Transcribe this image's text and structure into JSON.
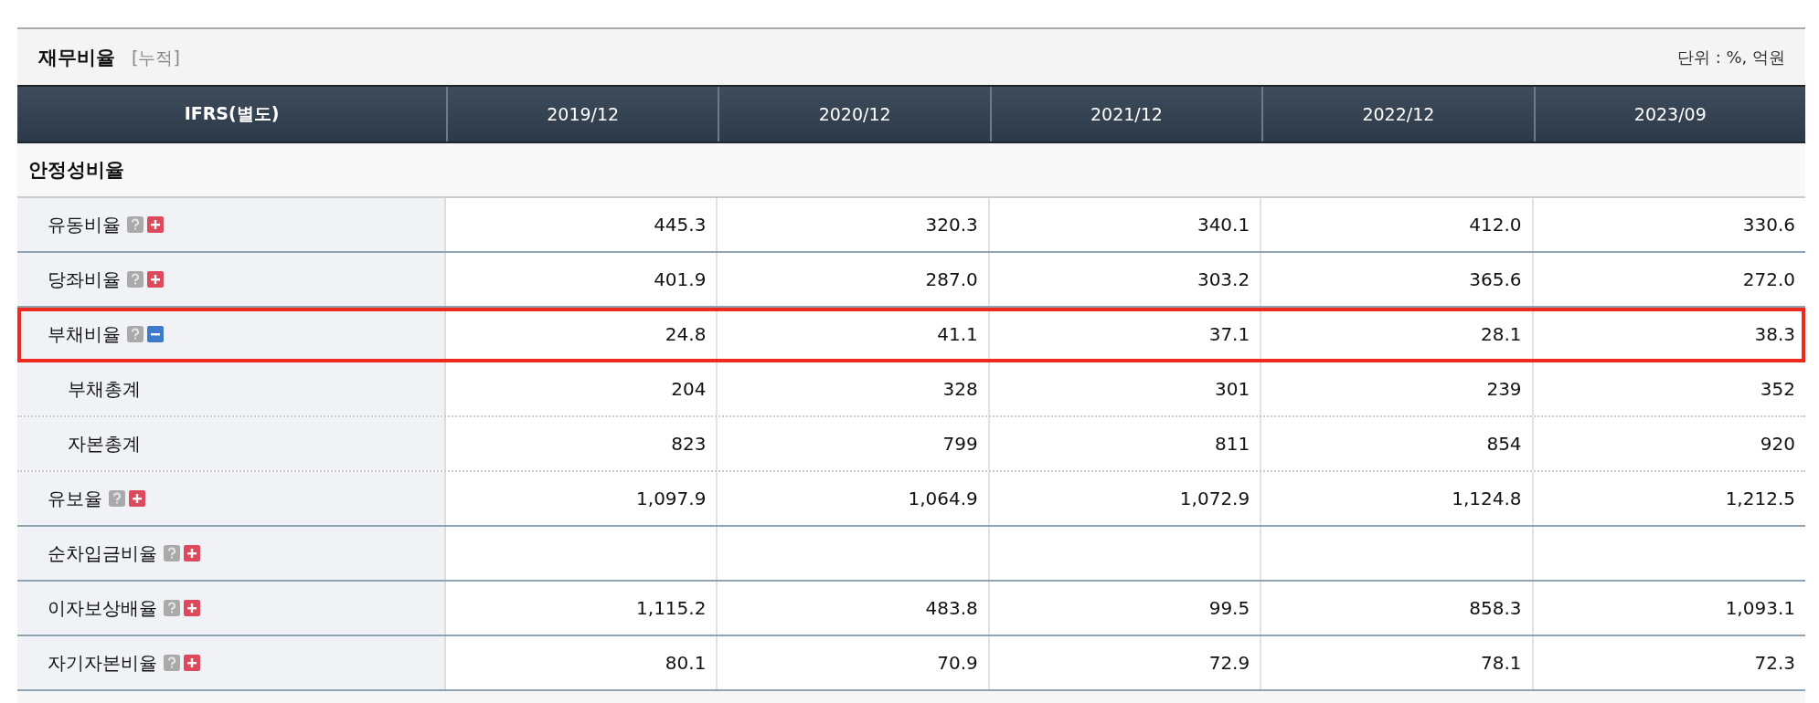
{
  "title": "재무비율",
  "title_note": "[누적]",
  "unit": "단위 : %, 억원",
  "columns": [
    "IFRS(별도)",
    "2019/12",
    "2020/12",
    "2021/12",
    "2022/12",
    "2023/09"
  ],
  "sections": [
    {
      "label": "안정성비율",
      "rows": [
        {
          "label": "유동비율",
          "expanded": false,
          "highlighted": false,
          "values": [
            "445.3",
            "320.3",
            "340.1",
            "412.0",
            "330.6"
          ]
        },
        {
          "label": "당좌비율",
          "expanded": false,
          "highlighted": false,
          "values": [
            "401.9",
            "287.0",
            "303.2",
            "365.6",
            "272.0"
          ]
        },
        {
          "label": "부채비율",
          "expanded": true,
          "highlighted": true,
          "values": [
            "24.8",
            "41.1",
            "37.1",
            "28.1",
            "38.3"
          ],
          "children": [
            {
              "label": "부채총계",
              "values": [
                "204",
                "328",
                "301",
                "239",
                "352"
              ]
            },
            {
              "label": "자본총계",
              "values": [
                "823",
                "799",
                "811",
                "854",
                "920"
              ]
            }
          ]
        },
        {
          "label": "유보율",
          "expanded": false,
          "highlighted": false,
          "values": [
            "1,097.9",
            "1,064.9",
            "1,072.9",
            "1,124.8",
            "1,212.5"
          ]
        },
        {
          "label": "순차입금비율",
          "expanded": false,
          "highlighted": false
        },
        {
          "label": "이자보상배율",
          "expanded": false,
          "highlighted": false,
          "values": [
            "1,115.2",
            "483.8",
            "99.5",
            "858.3",
            "1,093.1"
          ]
        },
        {
          "label": "자기자본비율",
          "expanded": false,
          "highlighted": false,
          "values": [
            "80.1",
            "70.9",
            "72.9",
            "78.1",
            "72.3"
          ]
        }
      ]
    }
  ]
}
